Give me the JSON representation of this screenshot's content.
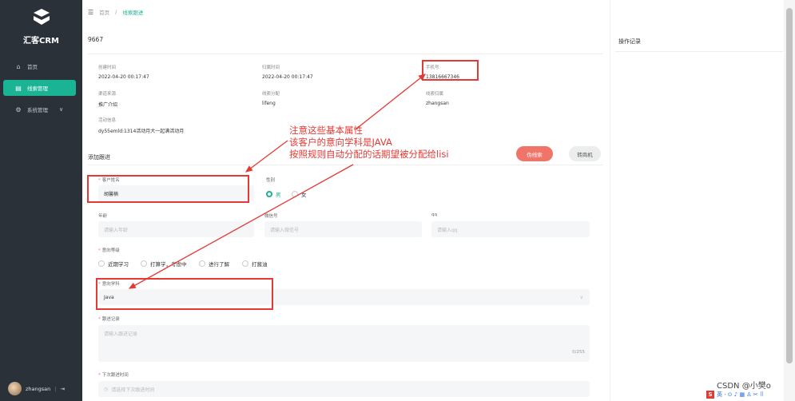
{
  "sidebar": {
    "logo_text": "汇客CRM",
    "items": [
      {
        "icon": "home-icon",
        "label": "首页"
      },
      {
        "icon": "list-icon",
        "label": "线索管理"
      },
      {
        "icon": "settings-icon",
        "label": "系统管理"
      }
    ],
    "user": {
      "name": "zhangsan",
      "separator": "|",
      "logout_icon": "logout-icon"
    }
  },
  "breadcrumb": {
    "home": "首页",
    "separator": "/",
    "current": "线索跟进"
  },
  "lead": {
    "id": "9667",
    "created_label": "创建时间",
    "created": "2022-04-20 00:17:47",
    "assigned_time_label": "归属时间",
    "assigned_time": "2022-04-20 00:17:47",
    "phone_label": "手机号",
    "phone": "13816667346",
    "source_label": "渠道来源",
    "source": "推广介绍",
    "dispatcher_label": "线索分配",
    "dispatcher": "lifeng",
    "owner_label": "线索归属",
    "owner": "zhangsan",
    "activity_label": "活动信息",
    "activity": "dy55emld:1314活动月大一起满活动月"
  },
  "actions": {
    "section_title": "添加跟进",
    "false_lead": "伪线索",
    "convert": "转商机"
  },
  "form": {
    "name_label": "客户姓名",
    "name_value": "胡馨楠",
    "gender_label": "性别",
    "gender_male": "男",
    "gender_female": "女",
    "age_label": "年龄",
    "age_placeholder": "请输入年龄",
    "wechat_label": "微信号",
    "wechat_placeholder": "请输入微信号",
    "qq_label": "qq",
    "qq_placeholder": "请输入qq",
    "intent_label": "意向等级",
    "intent_options": [
      "近期学习",
      "打算学，考虑中",
      "进行了解",
      "打酱油"
    ],
    "subject_label": "意向学科",
    "subject_value": "Java",
    "record_label": "跟进记录",
    "record_placeholder": "请输入跟进记录",
    "record_counter": "0/255",
    "next_label": "下次跟进时间",
    "next_placeholder": "请选择下次跟进时间"
  },
  "right_panel": {
    "title": "操作记录"
  },
  "annotation": {
    "lines": [
      "注意这些基本属性",
      "该客户的意向学科是JAVA",
      "按照规则自动分配的话期望被分配给lisi"
    ],
    "color": "#e53935"
  },
  "watermark": "CSDN @小樊o",
  "colors": {
    "sidebar": "#2b3138",
    "accent": "#1ab394",
    "danger": "#f17468"
  }
}
